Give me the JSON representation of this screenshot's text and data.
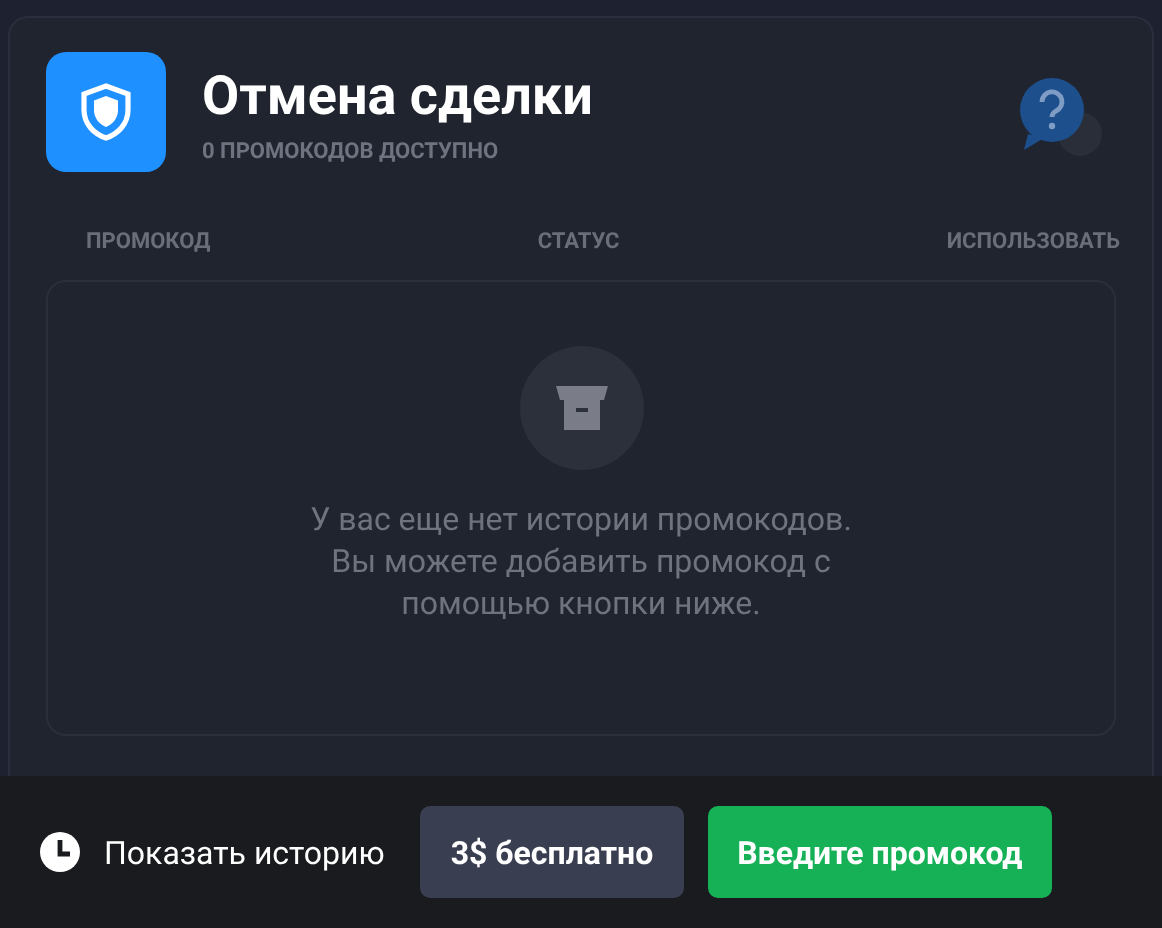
{
  "header": {
    "title": "Отмена сделки",
    "subtitle": "0 ПРОМОКОДОВ ДОСТУПНО"
  },
  "table": {
    "columns": [
      "ПРОМОКОД",
      "СТАТУС",
      "ИСПОЛЬЗОВАТЬ"
    ]
  },
  "empty_state": {
    "message": "У вас еще нет истории промокодов. Вы можете добавить промокод с помощью кнопки ниже."
  },
  "footer": {
    "history_link": "Показать историю",
    "buttons": [
      {
        "label": "3$ бесплатно",
        "kind": "secondary"
      },
      {
        "label": "Введите промокод",
        "kind": "primary"
      }
    ]
  }
}
